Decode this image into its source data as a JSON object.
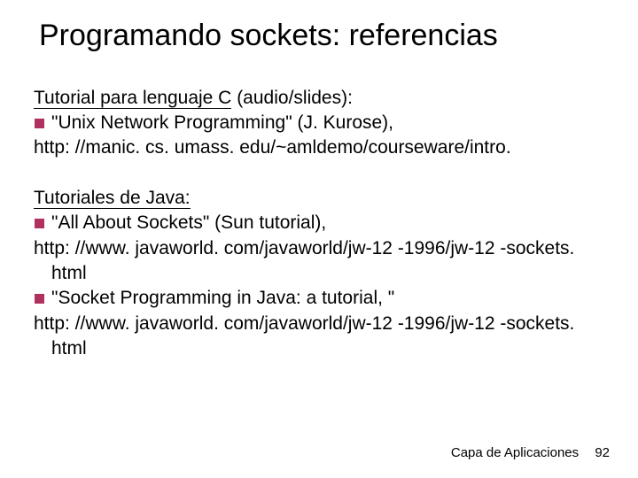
{
  "title": "Programando sockets: referencias",
  "section1": {
    "heading": "Tutorial para lenguaje C",
    "heading_suffix": " (audio/slides):",
    "bullet1_text": "\"Unix Network Programming\" (J. Kurose),",
    "url1": "http: //manic. cs. umass. edu/~amldemo/courseware/intro."
  },
  "section2": {
    "heading": "Tutoriales de Java:",
    "bullet1_text": "\"All About Sockets\" (Sun tutorial),",
    "bullet1_url": "http: //www. javaworld. com/javaworld/jw-12 -1996/jw-12 -sockets. html",
    "bullet2_text": "\"Socket Programming in Java: a tutorial, \"",
    "bullet2_url": "http: //www. javaworld. com/javaworld/jw-12 -1996/jw-12 -sockets. html"
  },
  "footer": {
    "label": "Capa de Aplicaciones",
    "page": "92"
  }
}
